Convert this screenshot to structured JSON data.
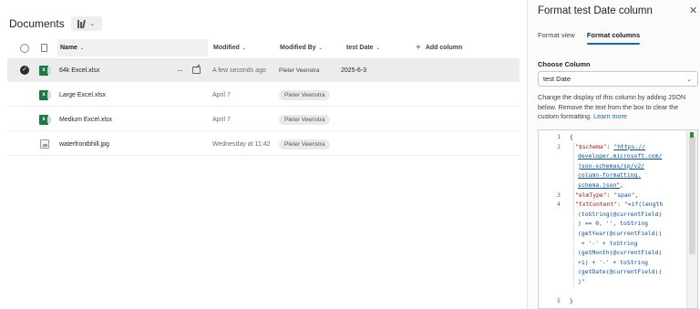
{
  "library": {
    "title": "Documents",
    "view_chevron": "⌄",
    "columns": {
      "name": "Name",
      "modified": "Modified",
      "modified_by": "Modified By",
      "test_date": "test Date",
      "add_column": "Add column",
      "sort_glyph": "⌄",
      "add_glyph": "+"
    },
    "files": [
      {
        "name": "64k Excel.xlsx",
        "modified": "A few seconds ago",
        "modified_by": "Pieter Veenstra",
        "test_date": "2025-6-3",
        "type": "excel",
        "selected": true
      },
      {
        "name": "Large Excel.xlsx",
        "modified": "April 7",
        "modified_by": "Pieter Veenstra",
        "test_date": "",
        "type": "excel",
        "selected": false
      },
      {
        "name": "Medium Excel.xlsx",
        "modified": "April 7",
        "modified_by": "Pieter Veenstra",
        "test_date": "",
        "type": "excel",
        "selected": false
      },
      {
        "name": "waterfrontbhill.jpg",
        "modified": "Wednesday at 11:42",
        "modified_by": "Pieter Veenstra",
        "test_date": "",
        "type": "image",
        "selected": false
      }
    ],
    "more_glyph": "···",
    "check_glyph": "✓",
    "excel_letter": "x"
  },
  "panel": {
    "title": "Format test Date column",
    "close_glyph": "✕",
    "tabs": [
      {
        "label": "Format view",
        "active": false
      },
      {
        "label": "Format columns",
        "active": true
      }
    ],
    "choose_column_label": "Choose Column",
    "selected_column": "test Date",
    "dropdown_chevron": "⌄",
    "description": "Change the display of this column by adding JSON below. Remove the text from the box to clear the custom formatting. ",
    "learn_more": "Learn more",
    "code_lines": [
      {
        "ln": "1",
        "text": "{"
      },
      {
        "ln": "2",
        "key": "\"$schema\"",
        "sep": ": ",
        "url": "\"https://"
      },
      {
        "ln": "",
        "url": "developer.microsoft.com/"
      },
      {
        "ln": "",
        "url": "json-schemas/sp/v2/"
      },
      {
        "ln": "",
        "url": "column-formatting."
      },
      {
        "ln": "",
        "url": "schema.json\"",
        "tail": ","
      },
      {
        "ln": "3",
        "key": "\"elmType\"",
        "sep": ": ",
        "str": "\"span\"",
        "tail": ","
      },
      {
        "ln": "4",
        "key": "\"txtContent\"",
        "sep": ": ",
        "str": "\"=if(length"
      },
      {
        "ln": "",
        "str": "(toString(@currentField)"
      },
      {
        "ln": "",
        "str": ") == 0, '', toString"
      },
      {
        "ln": "",
        "str": "(getYear(@currentField))"
      },
      {
        "ln": "",
        "str": " + '-' + toString"
      },
      {
        "ln": "",
        "str": "(getMonth(@currentField)"
      },
      {
        "ln": "",
        "str": "+1) + '-' + toString"
      },
      {
        "ln": "",
        "str": "(getDate(@currentField))"
      },
      {
        "ln": "",
        "str": ")\""
      },
      {
        "ln": "",
        "text": ""
      },
      {
        "ln": "5",
        "text": "}"
      }
    ]
  },
  "colors": {
    "accent": "#0f6cbd",
    "excel_green": "#1d7a45",
    "selected_row": "#ececec"
  }
}
